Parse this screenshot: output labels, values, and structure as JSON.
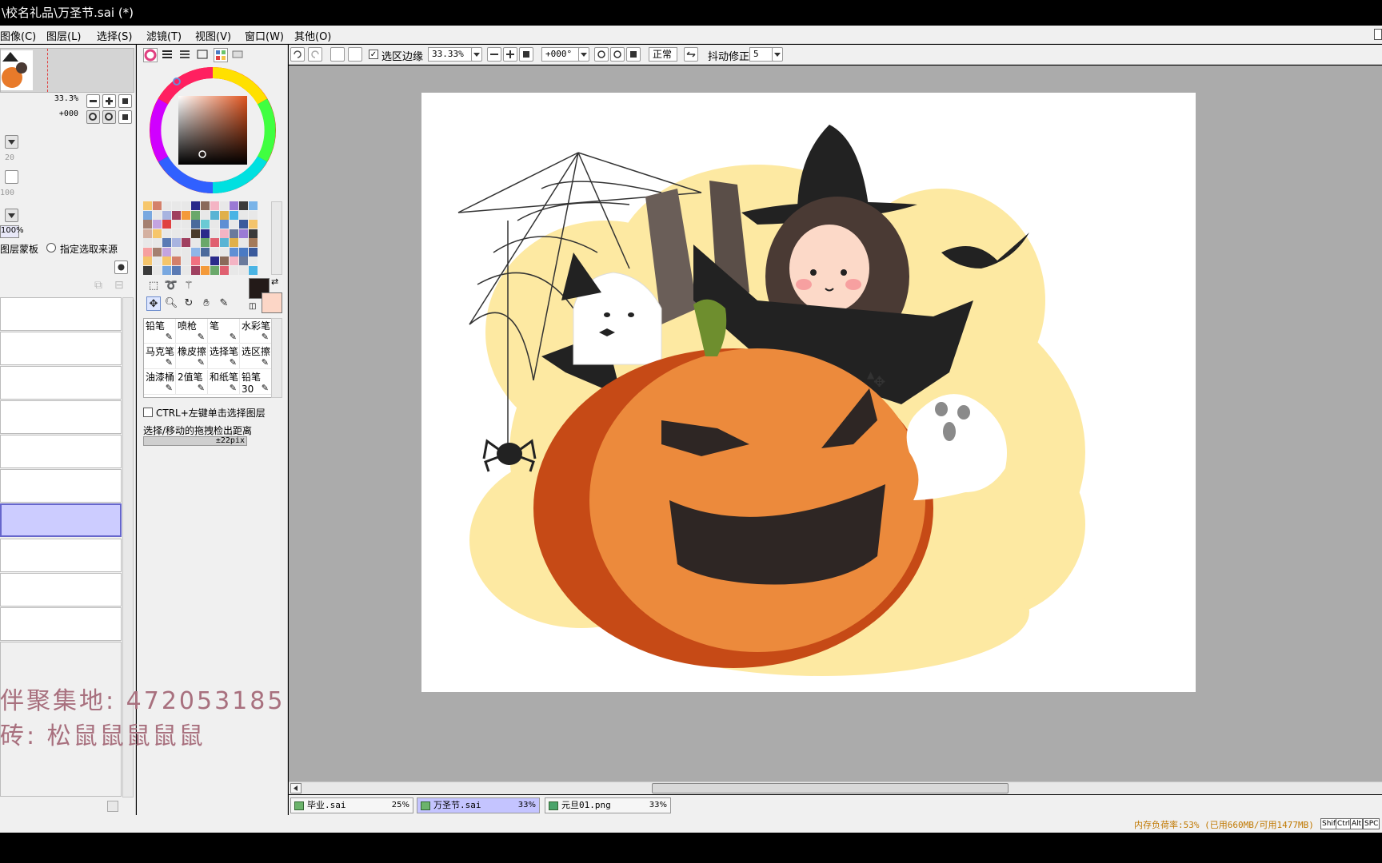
{
  "window": {
    "title": "\\校名礼品\\万圣节.sai (*)"
  },
  "menu": [
    {
      "label": "图像(C)"
    },
    {
      "label": "图层(L)"
    },
    {
      "label": "选择(S)"
    },
    {
      "label": "滤镜(T)"
    },
    {
      "label": "视图(V)"
    },
    {
      "label": "窗口(W)"
    },
    {
      "label": "其他(O)"
    }
  ],
  "navigator": {
    "zoom": "33.3%",
    "angle": "+000"
  },
  "layer_panel": {
    "values": [
      "20",
      "100"
    ],
    "opacity": "100%",
    "options": [
      "图层蒙板",
      "指定选取来源"
    ]
  },
  "color": {
    "foreground": "#231a18",
    "background": "#fcd6c6",
    "wheel_hue_marker": "#6b8cd6"
  },
  "swatches": [
    "#f6c66b",
    "#f49a3a",
    "#5f8fd4",
    "#79b3e8",
    "#e8e8e8",
    "#8a6a5a",
    "#a47a5a",
    "#d4806a",
    "#6aa86a",
    "#4a7ac4",
    "#79a8e0",
    "#8fb6e8",
    "#f4b4c4",
    "#f6a0a0",
    "#e8e8e8",
    "#e06070",
    "#3a5a9c",
    "#5a7ab4",
    "#4a6a9c",
    "#6a7a9c",
    "#a48070",
    "#f07080",
    "#5ab4d4",
    "#f4c46b",
    "#a8b4e0",
    "#6acad4",
    "#9a7ad4",
    "#c4a4e0",
    "#4a3a2a",
    "#e0b04a",
    "#d4b0a0",
    "#a04060",
    "#6a4a40",
    "#3a3a3a",
    "#e04040",
    "#2a2a8a",
    "#4ab4e4"
  ],
  "tools": {
    "brushes": [
      {
        "label": "铅笔"
      },
      {
        "label": "喷枪"
      },
      {
        "label": "笔"
      },
      {
        "label": "水彩笔"
      },
      {
        "label": "马克笔"
      },
      {
        "label": "橡皮擦"
      },
      {
        "label": "选择笔"
      },
      {
        "label": "选区擦"
      },
      {
        "label": "油漆桶"
      },
      {
        "label": "2值笔"
      },
      {
        "label": "和纸笔"
      },
      {
        "label": "铅笔30"
      }
    ],
    "ctrl_option": "CTRL+左键单击选择图层",
    "drag_label": "选择/移动的拖拽检出距离",
    "drag_value": "±22pix"
  },
  "toolbar": {
    "selection_edge_label": "选区边缘",
    "selection_edge_checked": true,
    "zoom": "33.33%",
    "rotation": "+000°",
    "blend_mode": "正常",
    "stabilizer_label": "抖动修正",
    "stabilizer_value": "5"
  },
  "documents": [
    {
      "name": "毕业.sai",
      "zoom": "25%",
      "active": false
    },
    {
      "name": "万圣节.sai",
      "zoom": "33%",
      "active": true
    },
    {
      "name": "元旦01.png",
      "zoom": "33%",
      "active": false
    }
  ],
  "status": {
    "memory": "内存负荷率:53% (已用660MB/可用1477MB)",
    "keys": [
      "Shift",
      "Ctrl",
      "Alt",
      "SPC"
    ]
  },
  "overlay": {
    "line1": "伴聚集地: 472053185",
    "line2": "砖: 松鼠鼠鼠鼠鼠"
  }
}
